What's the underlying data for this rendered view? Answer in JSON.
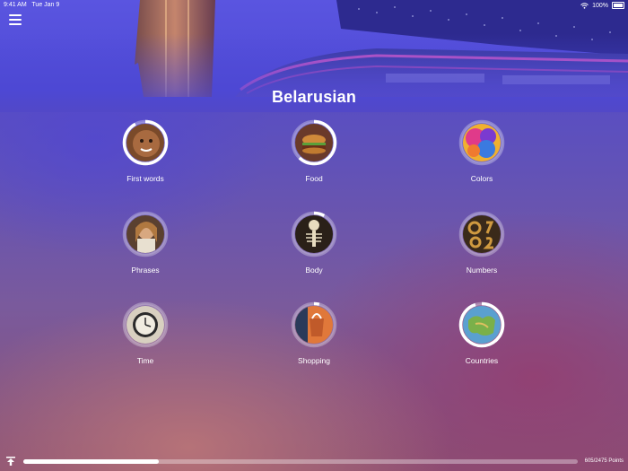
{
  "status": {
    "time": "9:41 AM",
    "date": "Tue Jan 9",
    "battery": "100%"
  },
  "title": "Belarusian",
  "topics": [
    {
      "label": "First words",
      "progress": 0.92,
      "icon": "child-face-icon"
    },
    {
      "label": "Food",
      "progress": 0.62,
      "icon": "burger-icon"
    },
    {
      "label": "Colors",
      "progress": 0.0,
      "icon": "paint-splash-icon"
    },
    {
      "label": "Phrases",
      "progress": 0.0,
      "icon": "woman-phone-icon"
    },
    {
      "label": "Body",
      "progress": 0.08,
      "icon": "skeleton-icon"
    },
    {
      "label": "Numbers",
      "progress": 0.0,
      "icon": "numbers-icon"
    },
    {
      "label": "Time",
      "progress": 0.0,
      "icon": "clock-icon"
    },
    {
      "label": "Shopping",
      "progress": 0.04,
      "icon": "shopping-icon"
    },
    {
      "label": "Countries",
      "progress": 0.95,
      "icon": "map-icon"
    }
  ],
  "footer": {
    "points_label": "605/2475 Points",
    "progress": 0.244
  },
  "colors": {
    "ring_fill": "#ffffff",
    "ring_track": "rgba(255,255,255,0.3)"
  }
}
